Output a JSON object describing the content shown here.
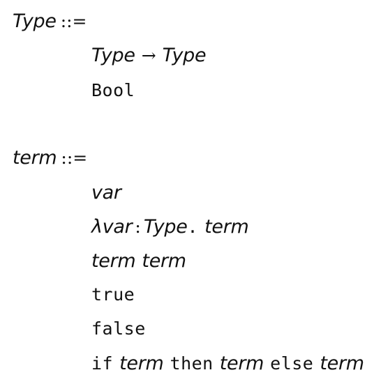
{
  "grammar": {
    "type_rule": {
      "name": "Type",
      "def_symbol": "::=",
      "alternatives": {
        "arrow": {
          "left": "Type",
          "arrow": "→",
          "right": "Type"
        },
        "bool": "Bool"
      }
    },
    "term_rule": {
      "name": "term",
      "def_symbol": "::=",
      "alternatives": {
        "var": "var",
        "lambda": {
          "lambda": "λ",
          "var": "var",
          "colon": ":",
          "type": "Type",
          "dot": ".",
          "body": "term"
        },
        "app": {
          "fn": "term",
          "arg": "term"
        },
        "true": "true",
        "false": "false",
        "if": {
          "if_kw": "if",
          "cond": "term",
          "then_kw": "then",
          "then_branch": "term",
          "else_kw": "else",
          "else_branch": "term"
        }
      }
    }
  }
}
